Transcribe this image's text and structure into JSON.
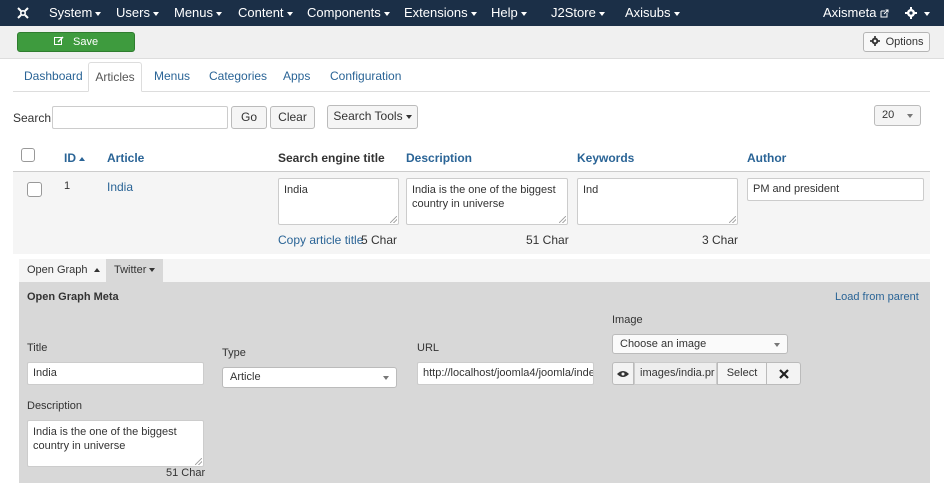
{
  "nav": {
    "items": [
      {
        "label": "System"
      },
      {
        "label": "Users"
      },
      {
        "label": "Menus"
      },
      {
        "label": "Content"
      },
      {
        "label": "Components"
      },
      {
        "label": "Extensions"
      },
      {
        "label": "Help"
      },
      {
        "label": "J2Store"
      },
      {
        "label": "Axisubs"
      }
    ],
    "user_label": "Axismeta"
  },
  "toolbar": {
    "save_label": "Save",
    "options_label": "Options"
  },
  "tabs": [
    {
      "label": "Dashboard"
    },
    {
      "label": "Articles",
      "active": true
    },
    {
      "label": "Menus"
    },
    {
      "label": "Categories"
    },
    {
      "label": "Apps"
    },
    {
      "label": "Configuration"
    }
  ],
  "search": {
    "label": "Search:",
    "value": "",
    "go_label": "Go",
    "clear_label": "Clear",
    "tools_label": "Search Tools",
    "limit_value": "20"
  },
  "table": {
    "headers": {
      "id": "ID",
      "article": "Article",
      "seo_title": "Search engine title",
      "description": "Description",
      "keywords": "Keywords",
      "author": "Author"
    },
    "rows": [
      {
        "id": "1",
        "article": "India",
        "seo_title": "India",
        "description": "India is the one of the biggest country in universe",
        "keywords": "Ind",
        "author": "PM and president",
        "copy_label": "Copy article title",
        "seo_count": "5 Char",
        "desc_count": "51 Char",
        "kw_count": "3 Char"
      }
    ]
  },
  "og": {
    "tabs": [
      {
        "label": "Open Graph"
      },
      {
        "label": "Twitter"
      }
    ],
    "heading": "Open Graph Meta",
    "load_label": "Load from parent",
    "title_label": "Title",
    "title_value": "India",
    "type_label": "Type",
    "type_value": "Article",
    "url_label": "URL",
    "url_value": "http://localhost/joomla4/joomla/inde",
    "image_label": "Image",
    "image_select": "Choose an image",
    "image_value": "images/india.pr",
    "select_label": "Select",
    "desc_label": "Description",
    "desc_value": "India is the one of the biggest country in universe",
    "desc_count": "51 Char"
  }
}
